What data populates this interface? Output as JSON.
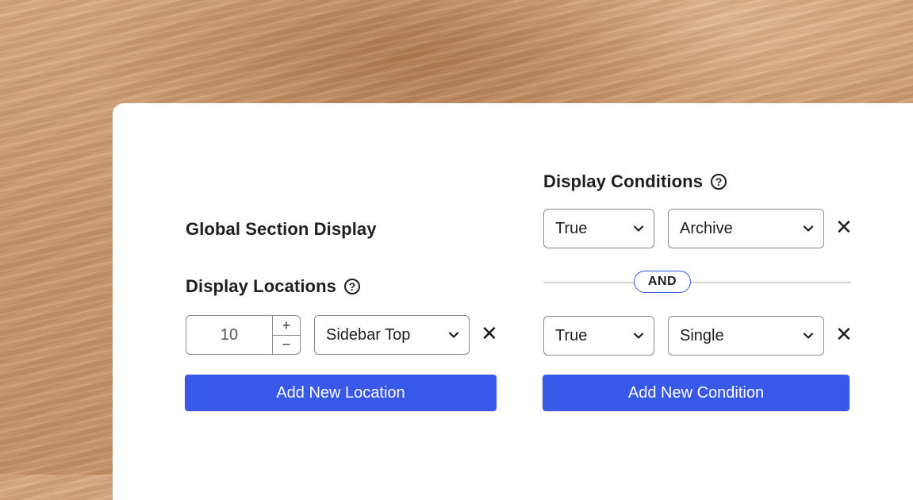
{
  "panel": {
    "title": "Global Section Display",
    "locations": {
      "heading": "Display Locations",
      "help_icon": "?",
      "priority_value": "10",
      "increment_label": "+",
      "decrement_label": "−",
      "location_selected": "Sidebar Top",
      "remove_label": "✕",
      "add_button": "Add New Location"
    },
    "conditions": {
      "heading": "Display Conditions",
      "help_icon": "?",
      "rows": [
        {
          "value_selected": "True",
          "type_selected": "Archive",
          "remove_label": "✕"
        },
        {
          "value_selected": "True",
          "type_selected": "Single",
          "remove_label": "✕"
        }
      ],
      "operator": "AND",
      "add_button": "Add New Condition"
    }
  },
  "colors": {
    "accent": "#3858e9",
    "text": "#1e1e1e",
    "border": "#8a8a8a"
  }
}
